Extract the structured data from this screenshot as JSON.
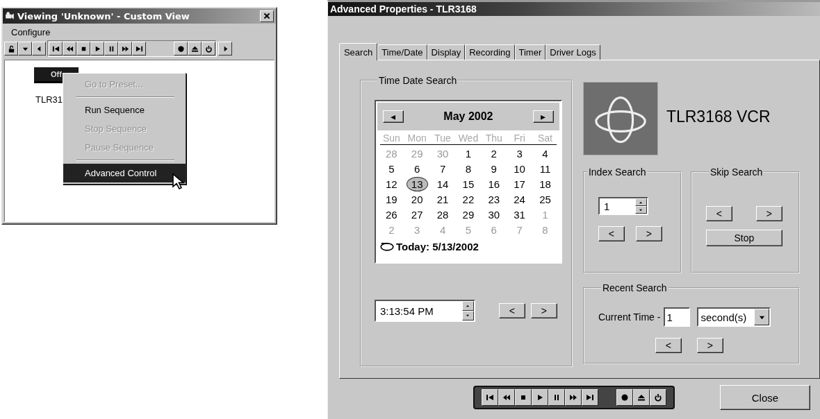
{
  "viewer_window": {
    "title": "Viewing 'Unknown' - Custom View",
    "menu": [
      "Configure"
    ],
    "toolbar": {
      "left": [
        {
          "kind": "lock"
        },
        {
          "kind": "dropdown"
        },
        {
          "kind": "scroll-left"
        }
      ],
      "transport": [
        {
          "kind": "first"
        },
        {
          "kind": "rewind"
        },
        {
          "kind": "stop"
        },
        {
          "kind": "play"
        },
        {
          "kind": "pause"
        },
        {
          "kind": "fastforward"
        },
        {
          "kind": "last"
        }
      ],
      "device": [
        {
          "kind": "record"
        },
        {
          "kind": "eject"
        },
        {
          "kind": "power"
        }
      ],
      "right": [
        {
          "kind": "scroll-right"
        }
      ]
    },
    "device": {
      "status": "Off",
      "label": "TLR31"
    },
    "context_menu": [
      {
        "kind": "item",
        "label": "Go to Preset...",
        "disabled": true,
        "selected": false
      },
      {
        "kind": "separator"
      },
      {
        "kind": "item",
        "label": "Run Sequence",
        "disabled": false,
        "selected": false
      },
      {
        "kind": "item",
        "label": "Stop Sequence",
        "disabled": true,
        "selected": false
      },
      {
        "kind": "item",
        "label": "Pause Sequence",
        "disabled": true,
        "selected": false
      },
      {
        "kind": "separator"
      },
      {
        "kind": "item",
        "label": "Advanced Control",
        "disabled": false,
        "selected": true
      }
    ]
  },
  "properties_window": {
    "title": "Advanced Properties - TLR3168",
    "tabs": [
      {
        "label": "Search",
        "selected": true
      },
      {
        "label": "Time/Date",
        "selected": false
      },
      {
        "label": "Display",
        "selected": false
      },
      {
        "label": "Recording",
        "selected": false
      },
      {
        "label": "Timer",
        "selected": false
      },
      {
        "label": "Driver Logs",
        "selected": false
      }
    ],
    "time_date_search": {
      "legend": "Time Date Search",
      "calendar": {
        "prev": "◂",
        "month": "May 2002",
        "next": "▸",
        "weekdays": [
          "Sun",
          "Mon",
          "Tue",
          "Wed",
          "Thu",
          "Fri",
          "Sat"
        ],
        "weeks": [
          [
            {
              "day": "28",
              "other_month": true,
              "selected": false
            },
            {
              "day": "29",
              "other_month": true,
              "selected": false
            },
            {
              "day": "30",
              "other_month": true,
              "selected": false
            },
            {
              "day": "1",
              "other_month": false,
              "selected": false
            },
            {
              "day": "2",
              "other_month": false,
              "selected": false
            },
            {
              "day": "3",
              "other_month": false,
              "selected": false
            },
            {
              "day": "4",
              "other_month": false,
              "selected": false
            }
          ],
          [
            {
              "day": "5",
              "other_month": false,
              "selected": false
            },
            {
              "day": "6",
              "other_month": false,
              "selected": false
            },
            {
              "day": "7",
              "other_month": false,
              "selected": false
            },
            {
              "day": "8",
              "other_month": false,
              "selected": false
            },
            {
              "day": "9",
              "other_month": false,
              "selected": false
            },
            {
              "day": "10",
              "other_month": false,
              "selected": false
            },
            {
              "day": "11",
              "other_month": false,
              "selected": false
            }
          ],
          [
            {
              "day": "12",
              "other_month": false,
              "selected": false
            },
            {
              "day": "13",
              "other_month": false,
              "selected": true
            },
            {
              "day": "14",
              "other_month": false,
              "selected": false
            },
            {
              "day": "15",
              "other_month": false,
              "selected": false
            },
            {
              "day": "16",
              "other_month": false,
              "selected": false
            },
            {
              "day": "17",
              "other_month": false,
              "selected": false
            },
            {
              "day": "18",
              "other_month": false,
              "selected": false
            }
          ],
          [
            {
              "day": "19",
              "other_month": false,
              "selected": false
            },
            {
              "day": "20",
              "other_month": false,
              "selected": false
            },
            {
              "day": "21",
              "other_month": false,
              "selected": false
            },
            {
              "day": "22",
              "other_month": false,
              "selected": false
            },
            {
              "day": "23",
              "other_month": false,
              "selected": false
            },
            {
              "day": "24",
              "other_month": false,
              "selected": false
            },
            {
              "day": "25",
              "other_month": false,
              "selected": false
            }
          ],
          [
            {
              "day": "26",
              "other_month": false,
              "selected": false
            },
            {
              "day": "27",
              "other_month": false,
              "selected": false
            },
            {
              "day": "28",
              "other_month": false,
              "selected": false
            },
            {
              "day": "29",
              "other_month": false,
              "selected": false
            },
            {
              "day": "30",
              "other_month": false,
              "selected": false
            },
            {
              "day": "31",
              "other_month": false,
              "selected": false
            },
            {
              "day": "1",
              "other_month": true,
              "selected": false
            }
          ],
          [
            {
              "day": "2",
              "other_month": true,
              "selected": false
            },
            {
              "day": "3",
              "other_month": true,
              "selected": false
            },
            {
              "day": "4",
              "other_month": true,
              "selected": false
            },
            {
              "day": "5",
              "other_month": true,
              "selected": false
            },
            {
              "day": "6",
              "other_month": true,
              "selected": false
            },
            {
              "day": "7",
              "other_month": true,
              "selected": false
            },
            {
              "day": "8",
              "other_month": true,
              "selected": false
            }
          ]
        ],
        "today": "Today: 5/13/2002"
      },
      "time": "3:13:54 PM",
      "buttons": [
        "<",
        ">"
      ]
    },
    "device_name": "TLR3168 VCR",
    "index_search": {
      "legend": "Index Search",
      "value": "1",
      "buttons": [
        "<",
        ">"
      ]
    },
    "skip_search": {
      "legend": "Skip Search",
      "buttons": [
        "<",
        ">"
      ],
      "stop": "Stop"
    },
    "recent_search": {
      "legend": "Recent Search",
      "label": "Current Time -",
      "value": "1",
      "unit": "second(s)",
      "buttons": [
        "<",
        ">"
      ]
    },
    "transport": {
      "transport": [
        {
          "kind": "first"
        },
        {
          "kind": "rewind"
        },
        {
          "kind": "stop"
        },
        {
          "kind": "play"
        },
        {
          "kind": "pause"
        },
        {
          "kind": "fastforward"
        },
        {
          "kind": "last"
        }
      ],
      "device": [
        {
          "kind": "record"
        },
        {
          "kind": "eject"
        },
        {
          "kind": "power"
        }
      ]
    },
    "close": "Close"
  }
}
